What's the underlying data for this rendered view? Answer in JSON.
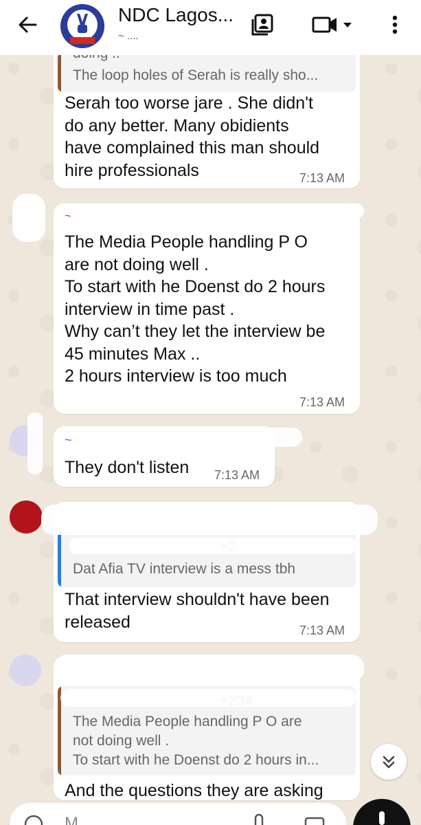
{
  "header": {
    "title": "NDC Lagos...",
    "subtitle": "~ ....",
    "icons": [
      "back-arrow-icon",
      "group-avatar",
      "contact-card-icon",
      "video-call-icon",
      "dropdown-icon",
      "more-options-icon"
    ]
  },
  "messages": [
    {
      "quote_partial": "doing ..",
      "quote_text": "The loop holes of Serah is really sho...",
      "text": "Serah too worse jare . She didn't\ndo any better. Many obidients\nhave complained this man should\nhire professionals",
      "time": "7:13 AM"
    },
    {
      "sender": "~",
      "text": "The Media People handling P O\nare not doing well .\nTo start with he Doenst do 2 hours\ninterview in time past .\nWhy can’t they let the interview be\n45 minutes Max ..\n2 hours interview is too much",
      "time": "7:13 AM"
    },
    {
      "sender": "~",
      "text": "They don't listen",
      "time": "7:13 AM"
    },
    {
      "quote_partial": "+2",
      "quote_text": "Dat Afia TV interview is a mess tbh",
      "text": "That interview shouldn't have been\nreleased",
      "time": "7:13 AM"
    },
    {
      "quote_sender": "+234",
      "quote_text": "The Media People handling P O are\nnot doing well .\nTo start with he Doenst do 2 hours in...",
      "text": "And the questions they are asking"
    }
  ],
  "input": {
    "placeholder": "M"
  }
}
